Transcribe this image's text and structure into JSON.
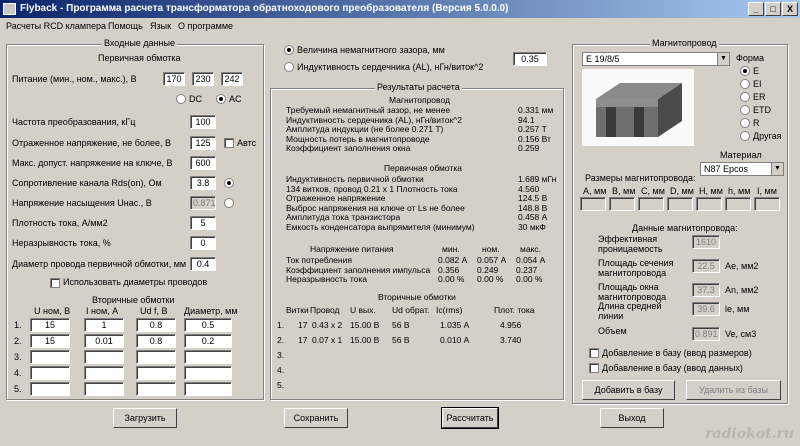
{
  "title": "Flyback - Программа расчета трансформатора обратноходового преобразователя (Версия 5.0.0.0)",
  "window_buttons": [
    "_",
    "□",
    "X"
  ],
  "menu": [
    "Расчеты RCD клампера",
    "Помощь",
    "Язык",
    "О программе"
  ],
  "input": {
    "legend": "Входные данные",
    "primary_title": "Первичная обмотка",
    "supply_label": "Питание (мин., ном., макс.), В",
    "supply_min": "170",
    "supply_nom": "230",
    "supply_max": "242",
    "dc": "DC",
    "ac": "AC",
    "freq_label": "Частота преобразования, кГц",
    "freq": "100",
    "refl_label": "Отраженное напряжение, не более, В",
    "refl": "125",
    "auto": "Автс",
    "vmax_label": "Макс. допуст. напряжение на ключе, В",
    "vmax": "600",
    "rds_label": "Сопротивление канала Rds(on), Ом",
    "rds": "3.8",
    "vsat_label": "Напряжение насыщения Uнас., В",
    "vsat": "0.871",
    "density_label": "Плотность тока, А/мм2",
    "density": "5",
    "cont_label": "Неразрывность тока, %",
    "cont": "0",
    "diam_label": "Диаметр провода первичной обмотки, мм",
    "diam": "0.4",
    "use_diam": "Использовать диаметры проводов",
    "secondary_title": "Вторичные обмотки",
    "sec_headers": [
      "U ном, В",
      "I ном, А",
      "Ud f, В",
      "Диаметр, мм"
    ],
    "sec_rows": [
      {
        "n": "1.",
        "u": "15",
        "i": "1",
        "ud": "0.8",
        "d": "0.5"
      },
      {
        "n": "2.",
        "u": "15",
        "i": "0.01",
        "ud": "0.8",
        "d": "0.2"
      },
      {
        "n": "3.",
        "u": "",
        "i": "",
        "ud": "",
        "d": ""
      },
      {
        "n": "4.",
        "u": "",
        "i": "",
        "ud": "",
        "d": ""
      },
      {
        "n": "5.",
        "u": "",
        "i": "",
        "ud": "",
        "d": ""
      }
    ]
  },
  "gap": {
    "opt1": "Величина немагнитного зазора, мм",
    "opt2": "Индуктивность сердечника (AL), нГн/виток^2",
    "value": "0.35"
  },
  "results": {
    "legend": "Результаты расчета",
    "mag_title": "Магнитопровод",
    "mag": [
      {
        "l": "Требуемый немагнитный зазор, не менее",
        "v": "0.331 мм"
      },
      {
        "l": "Индуктивность сердечника (AL), нГн/виток^2",
        "v": "94.1"
      },
      {
        "l": "Амплитуда индукции          (не более 0.271 Т)",
        "v": "0.257 Т"
      },
      {
        "l": "Мощность потерь в магнитопроводе",
        "v": "0.156 Вт"
      },
      {
        "l": "Коэффициент заполнения окна",
        "v": "0.259"
      }
    ],
    "prim_title": "Первичная обмотка",
    "prim": [
      {
        "l": "Индуктивность первичной обмотки",
        "v": "1.689 мГн"
      },
      {
        "l": " 134 витков,  провод 0.21 x 1          Плотность тока",
        "v": "4.560"
      },
      {
        "l": "Отраженное напряжение",
        "v": "124.5 В"
      },
      {
        "l": "Выброс напряжения на ключе от Ls не более",
        "v": "148.8 В"
      },
      {
        "l": "Амплитуда тока транзистора",
        "v": "0.458 А"
      },
      {
        "l": "Емкость конденсатора выпрямителя (минимум)",
        "v": "30 мкФ"
      }
    ],
    "supply_headers": [
      "Напряжение питания",
      "мин.",
      "ном.",
      "макс."
    ],
    "supply_rows": [
      {
        "l": "Ток потребления",
        "a": "0.082 А",
        "b": "0.057 А",
        "c": "0.054 А"
      },
      {
        "l": "Коэффициент заполнения импульса",
        "a": "0.356",
        "b": "0.249",
        "c": "0.237"
      },
      {
        "l": "Неразрывность тока",
        "a": "0.00 %",
        "b": "0.00 %",
        "c": "0.00 %"
      }
    ],
    "sec_title": "Вторичные обмотки",
    "sec_headers": [
      "Витки",
      "Провод",
      "U вых.",
      "Ud обрат.",
      "Ic(rms)",
      "Плот. тока"
    ],
    "sec_rows": [
      {
        "n": "1.",
        "w": "17",
        "p": "0.43 x 2",
        "u": "15.00 В",
        "ud": "56 В",
        "ic": "1.035 А",
        "j": "4.956"
      },
      {
        "n": "2.",
        "w": "17",
        "p": "0.07 x 1",
        "u": "15.00 В",
        "ud": "56 В",
        "ic": "0.010 А",
        "j": "3.740"
      },
      {
        "n": "3.",
        "w": "",
        "p": "",
        "u": "",
        "ud": "",
        "ic": "",
        "j": ""
      },
      {
        "n": "4.",
        "w": "",
        "p": "",
        "u": "",
        "ud": "",
        "ic": "",
        "j": ""
      },
      {
        "n": "5.",
        "w": "",
        "p": "",
        "u": "",
        "ud": "",
        "ic": "",
        "j": ""
      }
    ]
  },
  "core": {
    "legend": "Магнитопровод",
    "selected": "E 19/8/5",
    "form_label": "Форма",
    "forms": [
      "E",
      "EI",
      "ER",
      "ETD",
      "R",
      "Другая"
    ],
    "material_label": "Материал",
    "material": "N87 Epcos",
    "dims_label": "Размеры магнитопровода:",
    "dims_headers": [
      "A, мм",
      "B, мм",
      "C, мм",
      "D, мм",
      "H, мм",
      "h, мм",
      "I, мм"
    ],
    "data_label": "Данные магнитопровода:",
    "params": [
      {
        "l": "Эффективная проницаемость",
        "v": "1610",
        "u": ""
      },
      {
        "l": "Площадь сечения магнитопровода",
        "v": "22.5",
        "u": "Ae, мм2"
      },
      {
        "l": "Площадь окна магнитопровода",
        "v": "37.3",
        "u": "An, мм2"
      },
      {
        "l": "Длина средней линии",
        "v": "39.6",
        "u": "le, мм"
      },
      {
        "l": "Объем",
        "v": "0.891",
        "u": "Ve, см3"
      }
    ],
    "add_dims": "Добавление в базу (ввод размеров)",
    "add_data": "Добавление в базу (ввод данных)",
    "btn_add": "Добавить в базу",
    "btn_del": "Удалить из базы"
  },
  "buttons": {
    "load": "Загрузить",
    "save": "Сохранить",
    "calc": "Рассчитать",
    "exit": "Выход"
  },
  "watermark": "radiokot.ru"
}
